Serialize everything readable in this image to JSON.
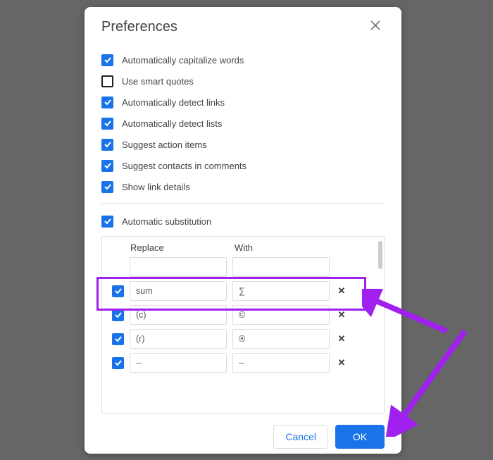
{
  "accent": "#1a73e8",
  "annotation_color": "#a020f0",
  "dialog": {
    "title": "Preferences",
    "options": [
      {
        "label": "Automatically capitalize words",
        "checked": true
      },
      {
        "label": "Use smart quotes",
        "checked": false
      },
      {
        "label": "Automatically detect links",
        "checked": true
      },
      {
        "label": "Automatically detect lists",
        "checked": true
      },
      {
        "label": "Suggest action items",
        "checked": true
      },
      {
        "label": "Suggest contacts in comments",
        "checked": true
      },
      {
        "label": "Show link details",
        "checked": true
      }
    ],
    "auto_sub": {
      "label": "Automatic substitution",
      "checked": true,
      "head_replace": "Replace",
      "head_with": "With",
      "blank": {
        "replace": "",
        "with": ""
      },
      "rows": [
        {
          "checked": true,
          "replace": "sum",
          "with": "∑",
          "highlighted": true
        },
        {
          "checked": true,
          "replace": "(c)",
          "with": "©"
        },
        {
          "checked": true,
          "replace": "(r)",
          "with": "®"
        },
        {
          "checked": true,
          "replace": "--",
          "with": "–"
        }
      ]
    },
    "buttons": {
      "cancel": "Cancel",
      "ok": "OK"
    }
  }
}
